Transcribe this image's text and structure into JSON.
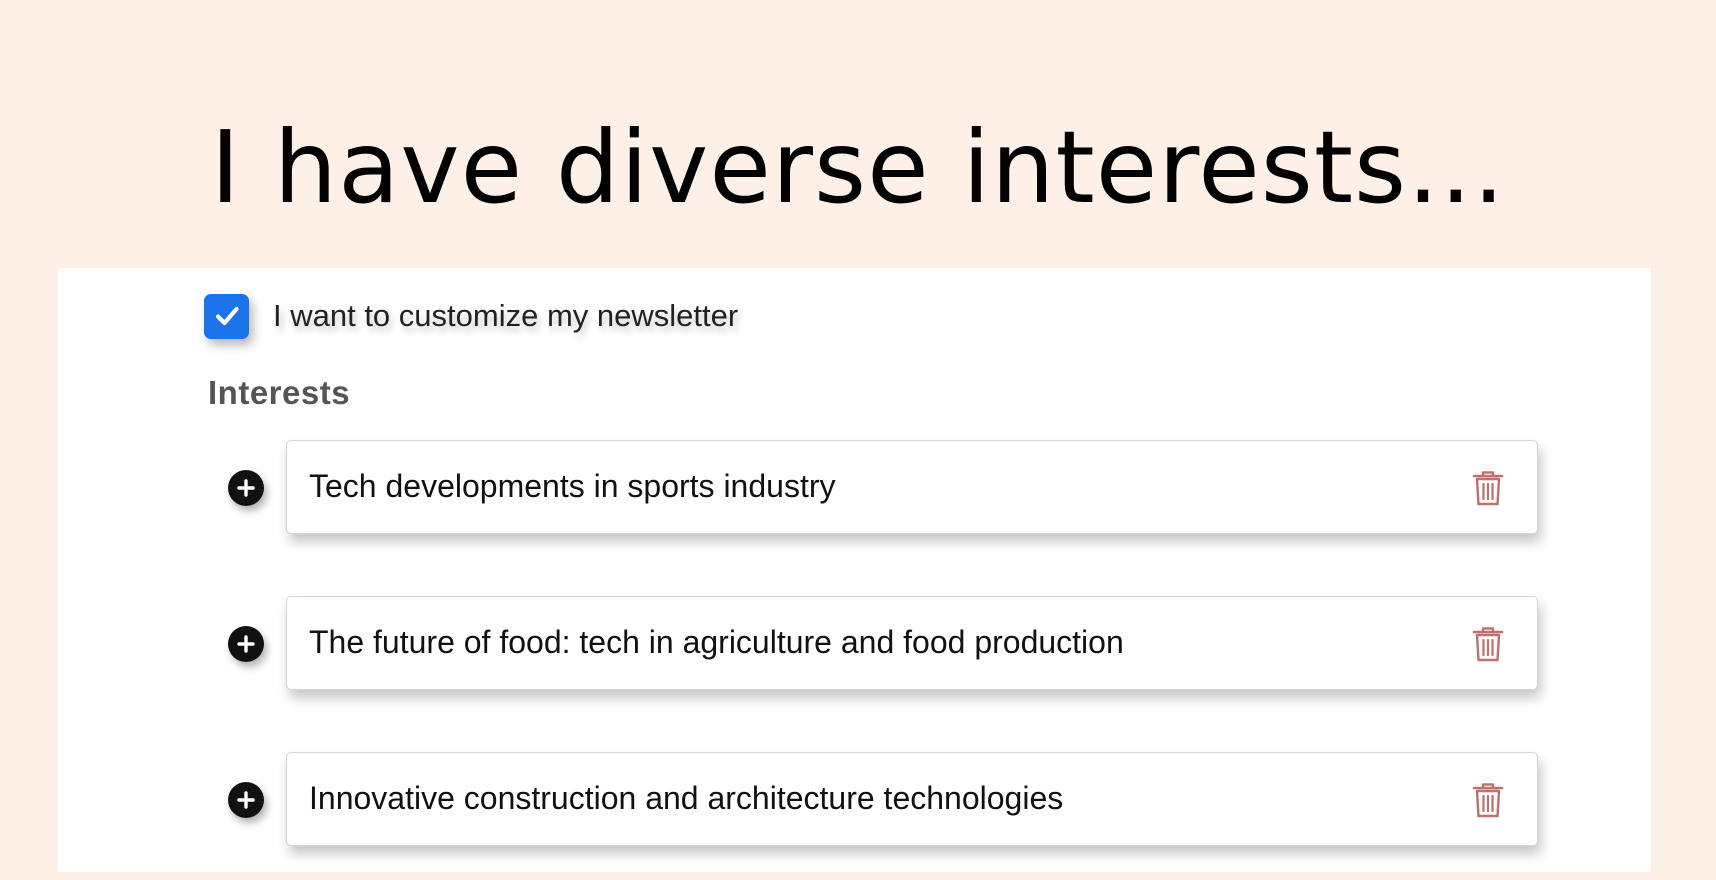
{
  "headline": "I have diverse interests...",
  "consent": {
    "label": "I want to customize my newsletter",
    "checked": true,
    "checkbox_color": "#1a73e8"
  },
  "interests": {
    "heading": "Interests",
    "items": [
      {
        "value": "Tech developments in sports industry",
        "add_icon": "plus-circle-icon",
        "delete_icon": "trash-icon"
      },
      {
        "value": "The future of food: tech in agriculture and food production",
        "add_icon": "plus-circle-icon",
        "delete_icon": "trash-icon"
      },
      {
        "value": "Innovative construction and architecture technologies",
        "add_icon": "plus-circle-icon",
        "delete_icon": "trash-icon"
      }
    ]
  },
  "colors": {
    "background": "#fdf0e6",
    "panel": "#ffffff",
    "trash": "#c0706c"
  }
}
